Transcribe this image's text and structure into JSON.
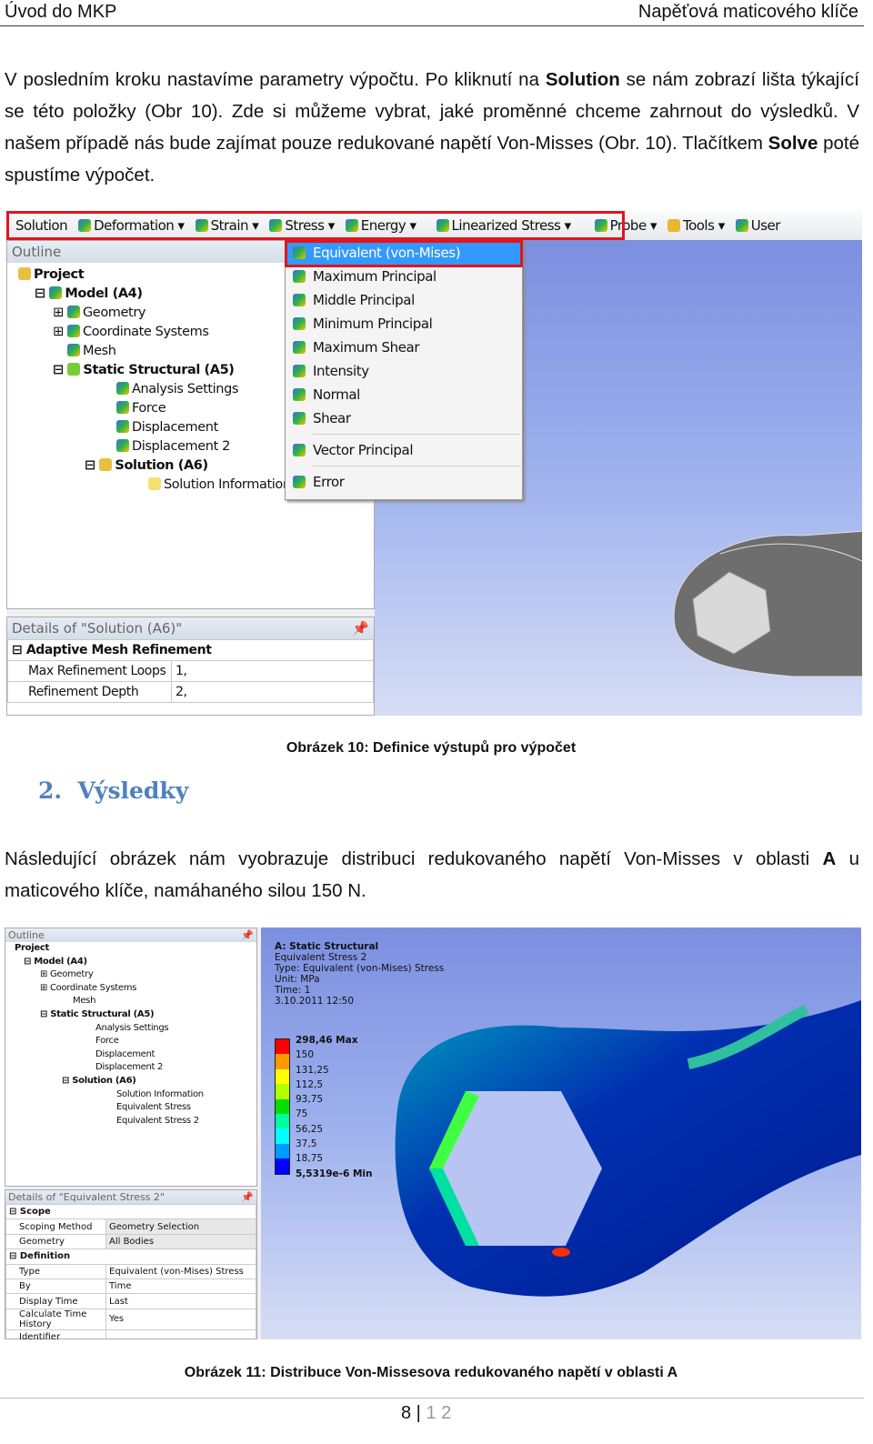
{
  "header": {
    "left": "Úvod do MKP",
    "right": "Napěťová maticového klíče"
  },
  "para1": {
    "t1": "V posledním kroku nastavíme parametry výpočtu. Po kliknutí na ",
    "b1": "Solution",
    "t2": " se nám zobrazí lišta týkající se této položky (Obr 10). Zde si můžeme vybrat, jaké proměnné chceme zahrnout do výsledků. V našem případě nás bude zajímat pouze redukované napětí Von-Misses (Obr. 10). Tlačítkem ",
    "b2": "Solve",
    "t3": " poté spustíme výpočet."
  },
  "fig1": {
    "toolbar": [
      "Solution",
      "Deformation ▾",
      "Strain ▾",
      "Stress ▾",
      "Energy ▾",
      "Linearized Stress ▾",
      "Probe ▾",
      "Tools ▾",
      "User"
    ],
    "outline_title": "Outline",
    "tree": [
      "Project",
      "Model (A4)",
      "Geometry",
      "Coordinate Systems",
      "Mesh",
      "Static Structural (A5)",
      "Analysis Settings",
      "Force",
      "Displacement",
      "Displacement 2",
      "Solution (A6)",
      "Solution Information"
    ],
    "menu": [
      "Equivalent (von-Mises)",
      "Maximum Principal",
      "Middle Principal",
      "Minimum Principal",
      "Maximum Shear",
      "Intensity",
      "Normal",
      "Shear",
      "Vector Principal",
      "Error"
    ],
    "details_title": "Details of \"Solution (A6)\"",
    "details_group": "Adaptive Mesh Refinement",
    "details_rows": [
      [
        "Max Refinement Loops",
        "1,"
      ],
      [
        "Refinement Depth",
        "2,"
      ]
    ],
    "highlight_color": "#e3141c"
  },
  "caption1": "Obrázek 10: Definice výstupů pro výpočet",
  "section": {
    "number": "2.",
    "title": "Výsledky"
  },
  "para2": {
    "t1": "Následující obrázek nám vyobrazuje distribuci redukovaného napětí Von-Misses v oblasti ",
    "b1": "A",
    "t2": " u maticového klíče, namáhaného silou 150 N."
  },
  "fig2": {
    "outline_title": "Outline",
    "tree": [
      "Project",
      "Model (A4)",
      "Geometry",
      "Coordinate Systems",
      "Mesh",
      "Static Structural (A5)",
      "Analysis Settings",
      "Force",
      "Displacement",
      "Displacement 2",
      "Solution (A6)",
      "Solution Information",
      "Equivalent Stress",
      "Equivalent Stress 2"
    ],
    "details_title": "Details of \"Equivalent Stress 2\"",
    "groups": [
      {
        "name": "Scope",
        "rows": [
          [
            "Scoping Method",
            "Geometry Selection"
          ],
          [
            "Geometry",
            "All Bodies"
          ]
        ]
      },
      {
        "name": "Definition",
        "rows": [
          [
            "Type",
            "Equivalent (von-Mises) Stress"
          ],
          [
            "By",
            "Time"
          ],
          [
            "Display Time",
            "Last"
          ],
          [
            "Calculate Time History",
            "Yes"
          ],
          [
            "Identifier",
            ""
          ]
        ]
      }
    ],
    "info": [
      "A: Static Structural",
      "Equivalent Stress 2",
      "Type: Equivalent (von-Mises) Stress",
      "Unit: MPa",
      "Time: 1",
      "3.10.2011 12:50"
    ],
    "legend": [
      "298,46 Max",
      "150",
      "131,25",
      "112,5",
      "93,75",
      "75",
      "56,25",
      "37,5",
      "18,75",
      "5,5319e-6 Min"
    ],
    "legend_colors": [
      "#ff0000",
      "#ff9900",
      "#ffff00",
      "#b4ff00",
      "#00e000",
      "#00ffa0",
      "#00ffff",
      "#0099ff",
      "#0000ff"
    ]
  },
  "caption2": "Obrázek 11: Distribuce Von-Missesova redukovaného napětí v oblasti A",
  "footer": {
    "page": "8",
    "total": "1 2"
  }
}
